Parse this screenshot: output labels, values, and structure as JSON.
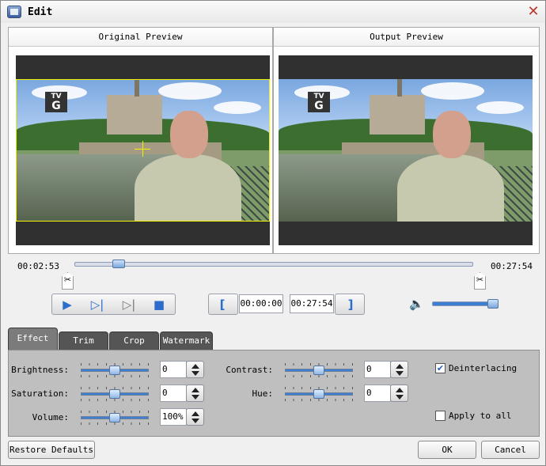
{
  "window": {
    "title": "Edit",
    "app_icon": "video-editor-icon",
    "close_icon": "close-x-icon"
  },
  "preview": {
    "original_label": "Original Preview",
    "output_label": "Output Preview",
    "channel_logo": {
      "top": "TV",
      "bottom": "G"
    }
  },
  "timeline": {
    "current_time": "00:02:53",
    "total_time": "00:27:54",
    "position_fraction": 0.099
  },
  "playback": {
    "buttons": [
      "play-icon",
      "next-frame-icon",
      "step-end-icon",
      "stop-icon"
    ]
  },
  "clip": {
    "start_marker_icon": "bracket-open-icon",
    "start_time": "00:00:00",
    "end_time": "00:27:54",
    "end_marker_icon": "bracket-close-icon"
  },
  "volume_main": {
    "icon": "speaker-icon",
    "level_fraction": 1.0
  },
  "tabs": [
    {
      "label": "Effect",
      "active": true
    },
    {
      "label": "Trim",
      "active": false
    },
    {
      "label": "Crop",
      "active": false
    },
    {
      "label": "Watermark",
      "active": false
    }
  ],
  "effect": {
    "brightness": {
      "label": "Brightness:",
      "value": "0"
    },
    "saturation": {
      "label": "Saturation:",
      "value": "0"
    },
    "volume": {
      "label": "Volume:",
      "value": "100%"
    },
    "contrast": {
      "label": "Contrast:",
      "value": "0"
    },
    "hue": {
      "label": "Hue:",
      "value": "0"
    },
    "deinterlacing": {
      "label": "Deinterlacing",
      "checked": true
    },
    "apply_all": {
      "label": "Apply to all",
      "checked": false
    }
  },
  "footer": {
    "restore": "Restore Defaults",
    "ok": "OK",
    "cancel": "Cancel"
  },
  "colors": {
    "accent": "#2c6ccb",
    "crop_frame": "#f2f200",
    "close": "#b73a2c"
  }
}
